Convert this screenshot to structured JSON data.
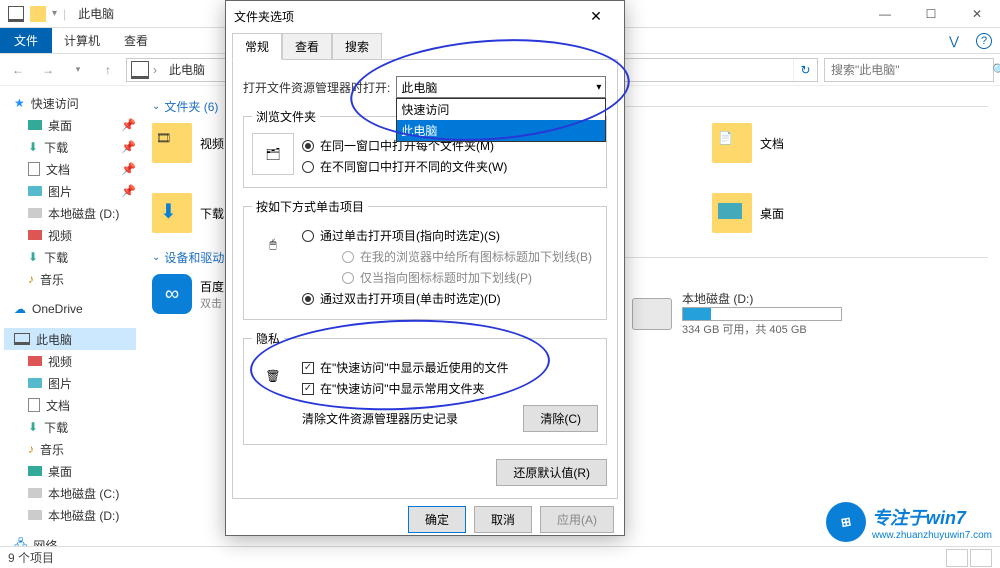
{
  "window": {
    "title": "此电脑",
    "min": "—",
    "max": "☐",
    "close": "✕"
  },
  "ribbon": {
    "file": "文件",
    "tabs": [
      "计算机",
      "查看"
    ]
  },
  "address": {
    "crumb": "此电脑",
    "search_placeholder": "搜索\"此电脑\""
  },
  "sidebar": {
    "quick": "快速访问",
    "quick_items": [
      "桌面",
      "下载",
      "文档",
      "图片",
      "本地磁盘 (D:)",
      "视频",
      "下载",
      "音乐"
    ],
    "onedrive": "OneDrive",
    "thispc": "此电脑",
    "thispc_items": [
      "视频",
      "图片",
      "文档",
      "下载",
      "音乐",
      "桌面",
      "本地磁盘 (C:)",
      "本地磁盘 (D:)"
    ],
    "network": "网络"
  },
  "content": {
    "group_folders": "文件夹 (6)",
    "folders": [
      "视频",
      "下载",
      "文档",
      "桌面"
    ],
    "group_devices": "设备和驱动",
    "baidu": {
      "name": "百度",
      "sub": "双击"
    },
    "drive": {
      "name": "本地磁盘 (D:)",
      "info": "334 GB 可用，共 405 GB"
    }
  },
  "dialog": {
    "title": "文件夹选项",
    "tabs": [
      "常规",
      "查看",
      "搜索"
    ],
    "open_to_label": "打开文件资源管理器时打开:",
    "dd_selected": "此电脑",
    "dd_options": [
      "快速访问",
      "此电脑"
    ],
    "browse": {
      "legend": "浏览文件夹",
      "same": "在同一窗口中打开每个文件夹(M)",
      "diff": "在不同窗口中打开不同的文件夹(W)"
    },
    "click": {
      "legend": "按如下方式单击项目",
      "single": "通过单击打开项目(指向时选定)(S)",
      "underline_all": "在我的浏览器中给所有图标标题加下划线(B)",
      "underline_point": "仅当指向图标标题时加下划线(P)",
      "double": "通过双击打开项目(单击时选定)(D)"
    },
    "privacy": {
      "legend": "隐私",
      "recent_files": "在\"快速访问\"中显示最近使用的文件",
      "frequent_folders": "在\"快速访问\"中显示常用文件夹",
      "clear_label": "清除文件资源管理器历史记录",
      "clear_btn": "清除(C)"
    },
    "restore": "还原默认值(R)",
    "ok": "确定",
    "cancel": "取消",
    "apply": "应用(A)"
  },
  "status": {
    "text": "9 个项目"
  },
  "watermark": {
    "text": "专注于win7",
    "url": "www.zhuanzhuyuwin7.com"
  }
}
